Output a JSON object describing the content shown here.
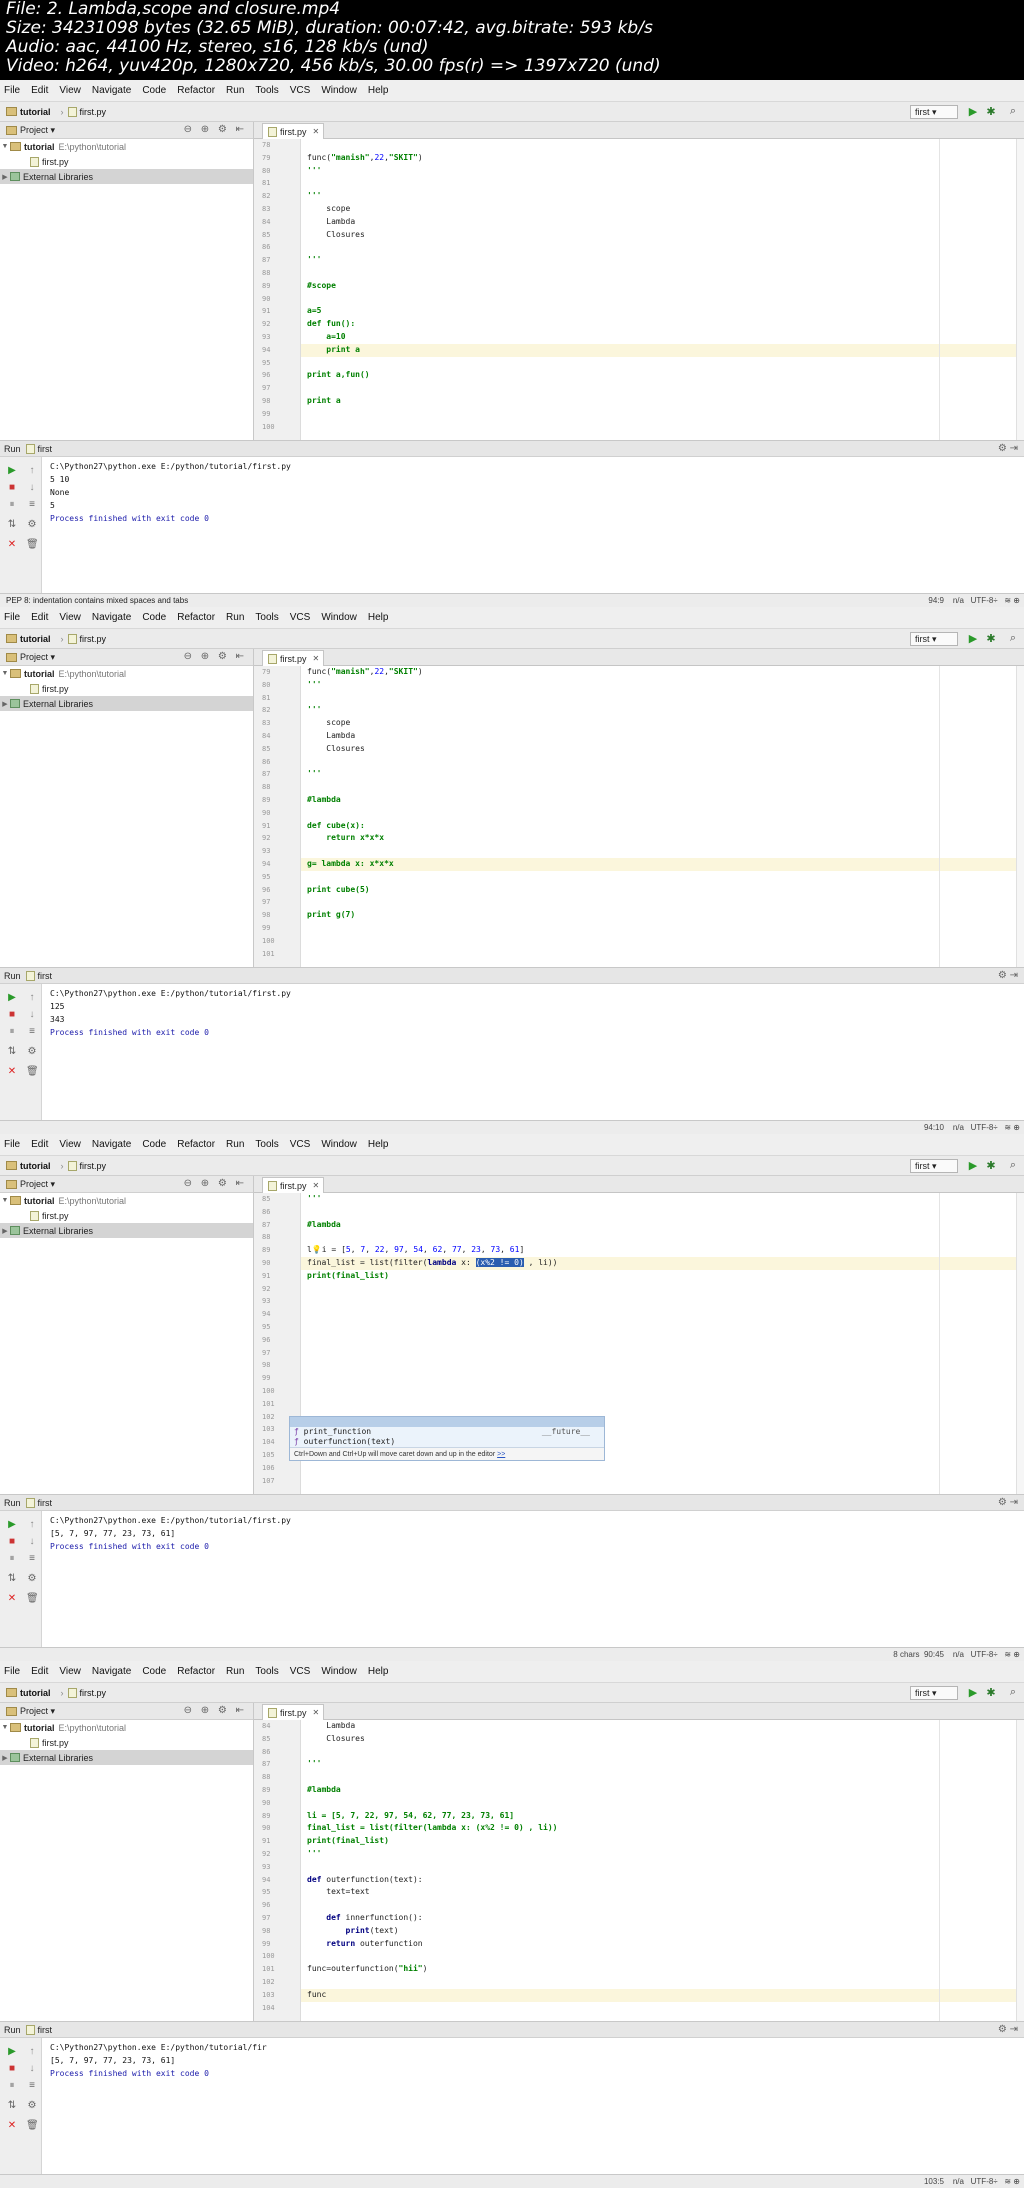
{
  "header": {
    "lines": [
      "File: 2. Lambda,scope and closure.mp4",
      "Size: 34231098 bytes (32.65 MiB), duration: 00:07:42, avg.bitrate: 593 kb/s",
      "Audio: aac, 44100 Hz, stereo, s16, 128 kb/s (und)",
      "Video: h264, yuv420p, 1280x720, 456 kb/s, 30.00 fps(r) => 1397x720 (und)"
    ]
  },
  "menu": [
    "File",
    "Edit",
    "View",
    "Navigate",
    "Code",
    "Refactor",
    "Run",
    "Tools",
    "VCS",
    "Window",
    "Help"
  ],
  "breadcrumb": {
    "project": "tutorial",
    "file": "first.py"
  },
  "run_config": "first",
  "project_panel": {
    "title": "Project",
    "root_name": "tutorial",
    "root_path": "E:\\python\\tutorial",
    "file": "first.py",
    "libraries": "External Libraries"
  },
  "editor_tab": "first.py",
  "run_panel": {
    "label": "Run",
    "config": "first"
  },
  "frames": [
    {
      "lines": [
        {
          "n": "78",
          "c": ""
        },
        {
          "n": "79",
          "c": "func(\"manish\",22,\"SKIT\")"
        },
        {
          "n": "80",
          "c": "'''"
        },
        {
          "n": "81",
          "c": ""
        },
        {
          "n": "82",
          "c": "'''"
        },
        {
          "n": "83",
          "c": "    scope"
        },
        {
          "n": "84",
          "c": "    Lambda"
        },
        {
          "n": "85",
          "c": "    Closures"
        },
        {
          "n": "86",
          "c": ""
        },
        {
          "n": "87",
          "c": "'''"
        },
        {
          "n": "88",
          "c": ""
        },
        {
          "n": "89",
          "c": "#scope"
        },
        {
          "n": "90",
          "c": ""
        },
        {
          "n": "91",
          "c": "a=5"
        },
        {
          "n": "92",
          "c": "def fun():"
        },
        {
          "n": "93",
          "c": "    a=10"
        },
        {
          "n": "94",
          "c": "    print a"
        },
        {
          "n": "95",
          "c": ""
        },
        {
          "n": "96",
          "c": "print a,fun()"
        },
        {
          "n": "97",
          "c": ""
        },
        {
          "n": "98",
          "c": "print a"
        },
        {
          "n": "99",
          "c": ""
        },
        {
          "n": "100",
          "c": ""
        }
      ],
      "console": [
        "C:\\Python27\\python.exe E:/python/tutorial/first.py",
        "5 10",
        "None",
        "5",
        "",
        "Process finished with exit code 0"
      ],
      "status_left": "PEP 8: indentation contains mixed spaces and tabs",
      "status_right": "94:9    n/a   UTF-8÷   ≋ ⊕"
    },
    {
      "lines": [
        {
          "n": "79",
          "c": "func(\"manish\",22,\"SKIT\")"
        },
        {
          "n": "80",
          "c": "'''"
        },
        {
          "n": "81",
          "c": ""
        },
        {
          "n": "82",
          "c": "'''"
        },
        {
          "n": "83",
          "c": "    scope"
        },
        {
          "n": "84",
          "c": "    Lambda"
        },
        {
          "n": "85",
          "c": "    Closures"
        },
        {
          "n": "86",
          "c": ""
        },
        {
          "n": "87",
          "c": "'''"
        },
        {
          "n": "88",
          "c": ""
        },
        {
          "n": "89",
          "c": "#lambda"
        },
        {
          "n": "90",
          "c": ""
        },
        {
          "n": "91",
          "c": "def cube(x):"
        },
        {
          "n": "92",
          "c": "    return x*x*x"
        },
        {
          "n": "93",
          "c": ""
        },
        {
          "n": "94",
          "c": "g= lambda x: x*x*x"
        },
        {
          "n": "95",
          "c": ""
        },
        {
          "n": "96",
          "c": "print cube(5)"
        },
        {
          "n": "97",
          "c": ""
        },
        {
          "n": "98",
          "c": "print g(7)"
        },
        {
          "n": "99",
          "c": ""
        },
        {
          "n": "100",
          "c": ""
        },
        {
          "n": "101",
          "c": ""
        }
      ],
      "console": [
        "C:\\Python27\\python.exe E:/python/tutorial/first.py",
        "125",
        "343",
        "",
        "Process finished with exit code 0"
      ],
      "status_left": "",
      "status_right": "94:10    n/a   UTF-8÷   ≋ ⊕"
    },
    {
      "lines": [
        {
          "n": "85",
          "c": "'''"
        },
        {
          "n": "86",
          "c": ""
        },
        {
          "n": "87",
          "c": "#lambda"
        },
        {
          "n": "88",
          "c": ""
        },
        {
          "n": "89",
          "c": "li = [5, 7, 22, 97, 54, 62, 77, 23, 73, 61]"
        },
        {
          "n": "90",
          "c": "final_list = list(filter(lambda x: (x%2 != 0) , li))"
        },
        {
          "n": "91",
          "c": "print(final_list)"
        },
        {
          "n": "92",
          "c": ""
        },
        {
          "n": "93",
          "c": ""
        },
        {
          "n": "94",
          "c": ""
        },
        {
          "n": "95",
          "c": ""
        },
        {
          "n": "96",
          "c": ""
        },
        {
          "n": "97",
          "c": ""
        },
        {
          "n": "98",
          "c": ""
        },
        {
          "n": "99",
          "c": ""
        },
        {
          "n": "100",
          "c": ""
        },
        {
          "n": "101",
          "c": ""
        },
        {
          "n": "102",
          "c": ""
        },
        {
          "n": "103",
          "c": ""
        },
        {
          "n": "104",
          "c": ""
        },
        {
          "n": "105",
          "c": ""
        },
        {
          "n": "106",
          "c": ""
        },
        {
          "n": "107",
          "c": ""
        }
      ],
      "console": [
        "C:\\Python27\\python.exe E:/python/tutorial/first.py",
        "[5, 7, 97, 77, 23, 73, 61]",
        "",
        "Process finished with exit code 0"
      ],
      "status_left": "",
      "status_right": "8 chars  90:45    n/a   UTF-8÷   ≋ ⊕"
    },
    {
      "lines": [
        {
          "n": "84",
          "c": "    Lambda"
        },
        {
          "n": "85",
          "c": "    Closures"
        },
        {
          "n": "86",
          "c": ""
        },
        {
          "n": "87",
          "c": "'''"
        },
        {
          "n": "88",
          "c": ""
        },
        {
          "n": "89",
          "c": "#lambda"
        },
        {
          "n": "90",
          "c": ""
        },
        {
          "n": "89",
          "c": "li = [5, 7, 22, 97, 54, 62, 77, 23, 73, 61]"
        },
        {
          "n": "90",
          "c": "final_list = list(filter(lambda x: (x%2 != 0) , li))"
        },
        {
          "n": "91",
          "c": "print(final_list)"
        },
        {
          "n": "92",
          "c": "'''"
        },
        {
          "n": "93",
          "c": ""
        },
        {
          "n": "94",
          "c": "def outerfunction(text):"
        },
        {
          "n": "95",
          "c": "    text=text"
        },
        {
          "n": "96",
          "c": ""
        },
        {
          "n": "97",
          "c": "    def innerfunction():"
        },
        {
          "n": "98",
          "c": "        print(text)"
        },
        {
          "n": "99",
          "c": "    return outerfunction"
        },
        {
          "n": "100",
          "c": ""
        },
        {
          "n": "101",
          "c": "func=outerfunction(\"hii\")"
        },
        {
          "n": "102",
          "c": ""
        },
        {
          "n": "103",
          "c": "func"
        },
        {
          "n": "104",
          "c": ""
        }
      ],
      "console": [
        "C:\\Python27\\python.exe E:/python/tutorial/fir",
        "[5, 7, 97, 77, 23, 73, 61]",
        "",
        "Process finished with exit code 0"
      ],
      "status_left": "",
      "status_right": "103:5    n/a   UTF-8÷   ≋ ⊕",
      "completion": {
        "items": [
          {
            "name": "print_function",
            "tail": "__future__"
          },
          {
            "name": "outerfunction(text)",
            "tail": ""
          }
        ],
        "hint": "Ctrl+Down and Ctrl+Up will move caret down and up in the editor",
        "hint_link": ">>"
      }
    }
  ]
}
